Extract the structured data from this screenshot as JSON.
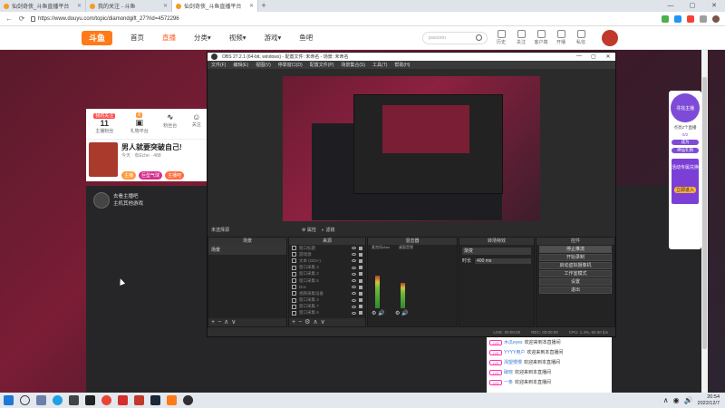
{
  "browser": {
    "tabs": [
      {
        "label": "仙剑奇侠_斗鱼直播平台",
        "active": false
      },
      {
        "label": "我的关注 - 斗鱼",
        "active": false
      },
      {
        "label": "仙剑奇侠_斗鱼直播平台",
        "active": true
      }
    ],
    "url": "https://www.douyu.com/topic/diamondgift_27?rid=4572296",
    "window_controls": [
      "—",
      "▢",
      "✕"
    ]
  },
  "douyu": {
    "logo": "斗鱼",
    "nav": [
      "首页",
      "直播",
      "分类▾",
      "视频▾",
      "游戏▾",
      "鱼吧"
    ],
    "nav_active_index": 1,
    "search_placeholder": "passion",
    "actions": [
      "历史",
      "关注",
      "客户端",
      "开播",
      "私信"
    ],
    "stats": [
      {
        "value": "11",
        "label": "主播粉丝",
        "badge": "我的关注"
      },
      {
        "value": "",
        "label": "礼物平台",
        "badge": "6"
      },
      {
        "value": "",
        "label": "粉丝台"
      },
      {
        "value": "",
        "label": "关注"
      }
    ],
    "streamer_title": "男人就要突破自己!",
    "streamer_meta": "今天 · 有Eche · 488",
    "room_tags": [
      "主播",
      "巨型气球",
      "主播吧"
    ],
    "rec_text_1": "去看主播吧",
    "rec_text_2": "主机其他游戏",
    "right_panel": {
      "event_circle": "寻找主播",
      "progress_label": "点亮2个直播",
      "progress_value": "0/2",
      "btn1": "成为",
      "btn2": "神仙礼物",
      "promo_title": "活动专属兑换",
      "promo_btn": "立即进入"
    },
    "chat": [
      {
        "level": "LV5",
        "name": "木瓜eyes",
        "text": "欢迎来到本直播间"
      },
      {
        "level": "LV5",
        "name": "YYYY用户",
        "text": "欢迎来到本直播间"
      },
      {
        "level": "LV5",
        "name": "渴望慢慢",
        "text": "欢迎来到本直播间"
      },
      {
        "level": "LV4",
        "name": "破晓",
        "text": "欢迎来到本直播间"
      },
      {
        "level": "LV3",
        "name": "一条",
        "text": "欢迎来到本直播间"
      }
    ]
  },
  "obs": {
    "title": "OBS 27.2.1 (64-bit, windows) - 配置文件: 未命名 - 场景: 未命名",
    "menu": [
      "文件(F)",
      "编辑(E)",
      "视图(V)",
      "停靠窗口(D)",
      "配置文件(P)",
      "场景集合(S)",
      "工具(T)",
      "帮助(H)"
    ],
    "no_source": "未选择源",
    "props_btn": "属性",
    "filter_btn": "滤镜",
    "docks": {
      "scenes": {
        "title": "场景",
        "items": [
          "场景"
        ]
      },
      "sources": {
        "title": "来源",
        "items": [
          "窗口标题",
          "游戏源",
          "文本 (GDI+)",
          "窗口采集 3",
          "窗口采集 2",
          "窗口采集 5",
          "Doc",
          "视频采集设备",
          "窗口采集 4",
          "窗口采集 7",
          "窗口采集 6"
        ]
      },
      "mixer": {
        "title": "混音器",
        "ch1": "麦克风/Aux",
        "ch2": "桌面音频",
        "levels": [
          0.62,
          0.48
        ]
      },
      "transitions": {
        "title": "转场特效",
        "type": "渐变",
        "duration_label": "时长",
        "duration": "400 ms"
      },
      "controls": {
        "title": "控件",
        "buttons": [
          "停止推流",
          "开始录制",
          "启动虚拟摄像机",
          "工作室模式",
          "设置",
          "退出"
        ]
      }
    },
    "status": [
      "LIVE: 00:00:00",
      "REC: 00:00:00",
      "CPU: 1.4%, 60.00 fps"
    ]
  },
  "taskbar": {
    "time": "20:54",
    "date": "2022/12/7"
  },
  "colors": {
    "accent": "#ff5d23",
    "obs_bg": "#2b2b2b"
  }
}
